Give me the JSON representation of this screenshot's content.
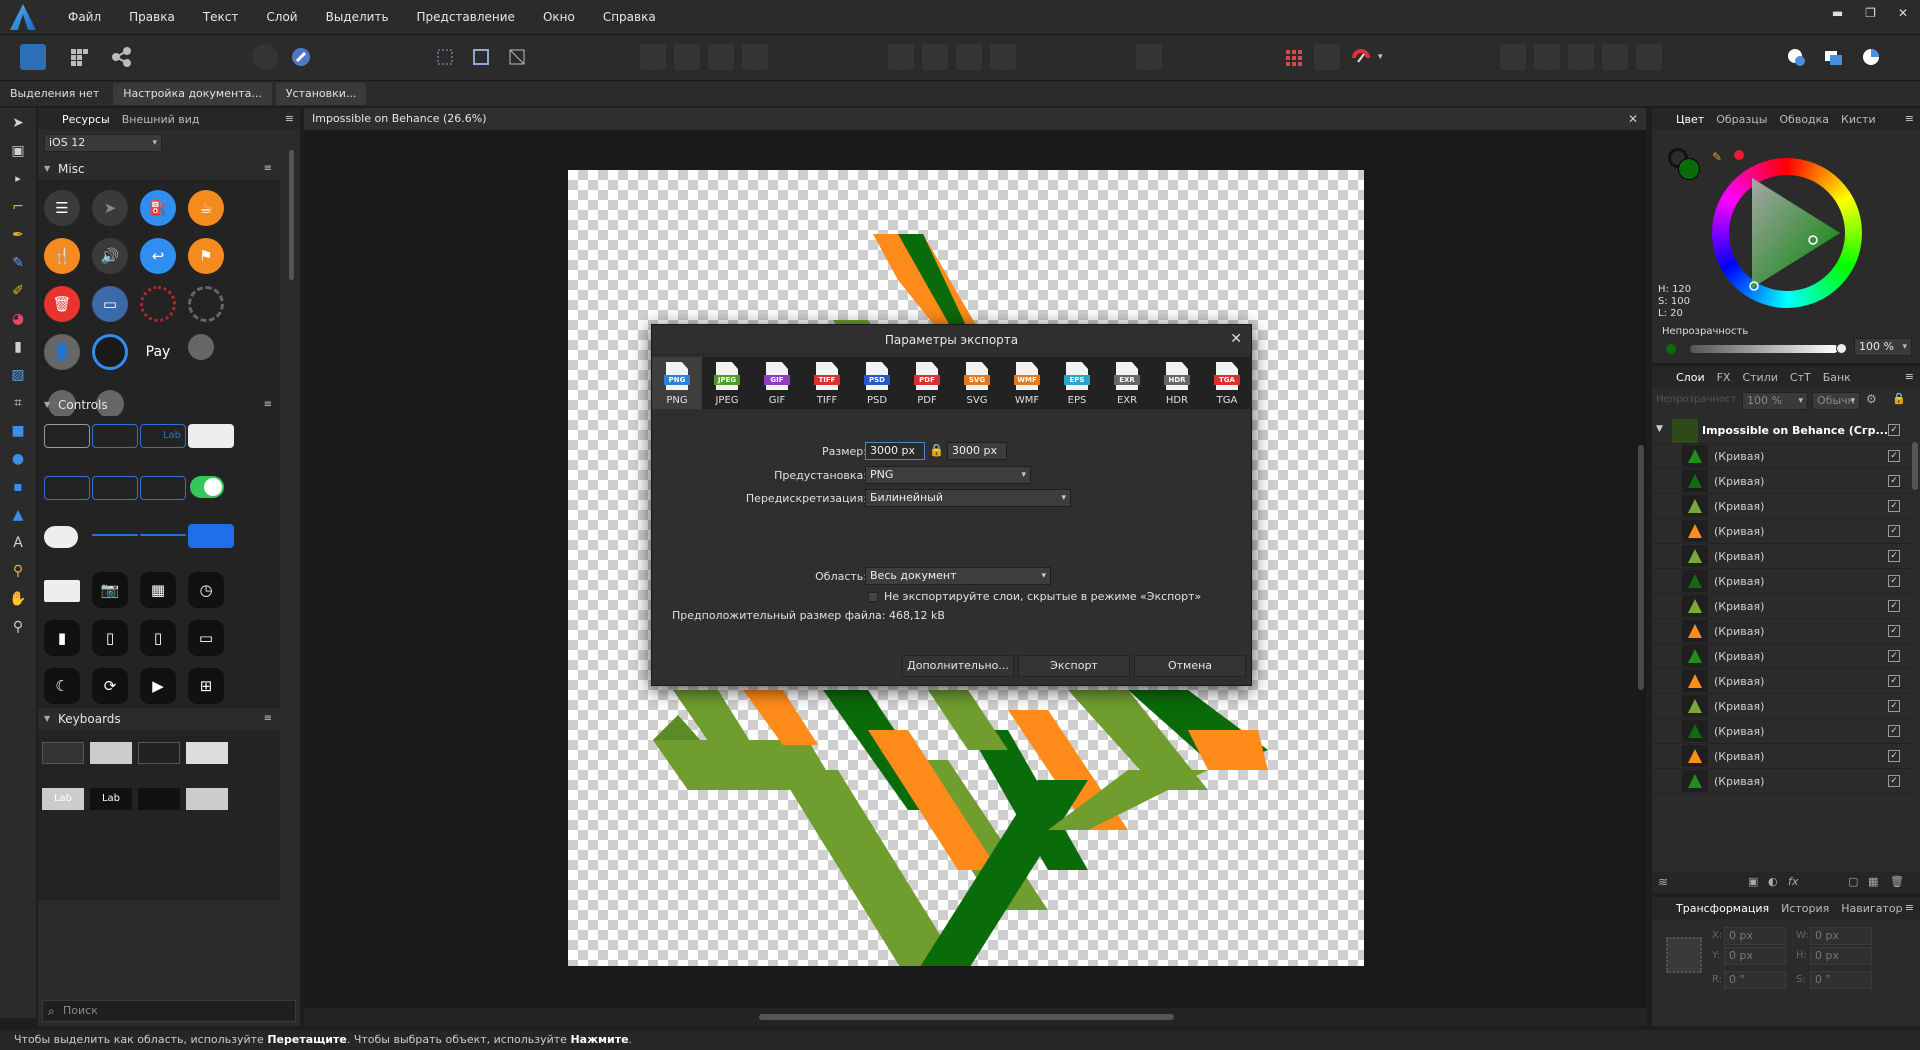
{
  "menubar": {
    "items": [
      "Файл",
      "Правка",
      "Текст",
      "Слой",
      "Выделить",
      "Представление",
      "Окно",
      "Справка"
    ]
  },
  "context_bar": {
    "selection": "Выделения нет",
    "doc_setup": "Настройка документа...",
    "preferences": "Установки..."
  },
  "assets_panel": {
    "tabs": [
      "Ресурсы",
      "Внешний вид"
    ],
    "category": "iOS 12",
    "sections": [
      "Misc",
      "Controls",
      "Keyboards"
    ],
    "search_placeholder": "Поиск",
    "control_label": "Lab",
    "keyboard_label": "Lab"
  },
  "document": {
    "title": "Impossible on Behance (26.6%)"
  },
  "export_dialog": {
    "title": "Параметры экспорта",
    "formats": [
      "PNG",
      "JPEG",
      "GIF",
      "TIFF",
      "PSD",
      "PDF",
      "SVG",
      "WMF",
      "EPS",
      "EXR",
      "HDR",
      "TGA"
    ],
    "format_badges": [
      "PNG",
      "JPEG",
      "GIF",
      "TIFF",
      "PSD",
      "PDF",
      "SVG",
      "WMF",
      "EPS",
      "EXR",
      "HDR",
      "TGA"
    ],
    "format_colors": [
      "#2f7fd6",
      "#4c9a2a",
      "#8c3fc4",
      "#d9322e",
      "#2458c4",
      "#d9322e",
      "#e4781c",
      "#e4781c",
      "#2aa3c9",
      "#666666",
      "#666666",
      "#d9322e"
    ],
    "selected_format": "PNG",
    "size_label": "Размер:",
    "width": "3000 px",
    "height": "3000 px",
    "preset_label": "Предустановка:",
    "preset": "PNG",
    "resample_label": "Передискретизация:",
    "resample": "Билинейный",
    "area_label": "Область:",
    "area": "Весь документ",
    "hidden_layers": "Не экспортируйте слои, скрытые в режиме «Экспорт»",
    "filesize": "Предположительный размер файла: 468,12 kB",
    "btn_more": "Дополнительно...",
    "btn_export": "Экспорт",
    "btn_cancel": "Отмена"
  },
  "color_panel": {
    "tabs": [
      "Цвет",
      "Образцы",
      "Обводка",
      "Кисти"
    ],
    "h": "H: 120",
    "s": "S: 100",
    "l": "L: 20",
    "opacity_label": "Непрозрачность",
    "opacity_value": "100 %",
    "fill_color": "#0a6b0a",
    "accent": "#e81d2f"
  },
  "layers_panel": {
    "tabs": [
      "Слои",
      "FX",
      "Стили",
      "СтТ",
      "Банк"
    ],
    "opacity_label": "Непрозрачность:",
    "opacity_value": "100 %",
    "blend_mode": "Обычн",
    "group_name": "Impossible on Behance (Сгр...",
    "layer_name": "(Кривая)",
    "layers": [
      {
        "name": "(Кривая)",
        "color": "#1f8f1a"
      },
      {
        "name": "(Кривая)",
        "color": "#0f6b0f"
      },
      {
        "name": "(Кривая)",
        "color": "#7aa83a"
      },
      {
        "name": "(Кривая)",
        "color": "#ff8c1a"
      },
      {
        "name": "(Кривая)",
        "color": "#7aa83a"
      },
      {
        "name": "(Кривая)",
        "color": "#0f6b0f"
      },
      {
        "name": "(Кривая)",
        "color": "#7aa83a"
      },
      {
        "name": "(Кривая)",
        "color": "#ff8c1a"
      },
      {
        "name": "(Кривая)",
        "color": "#1f8f1a"
      },
      {
        "name": "(Кривая)",
        "color": "#ff8c1a"
      },
      {
        "name": "(Кривая)",
        "color": "#7aa83a"
      },
      {
        "name": "(Кривая)",
        "color": "#0f6b0f"
      },
      {
        "name": "(Кривая)",
        "color": "#ff8c1a"
      },
      {
        "name": "(Кривая)",
        "color": "#1f8f1a"
      }
    ]
  },
  "transform_panel": {
    "tabs": [
      "Трансформация",
      "История",
      "Навигатор"
    ],
    "x": "0 px",
    "y": "0 px",
    "w": "0 px",
    "h": "0 px",
    "r": "0 °",
    "s": "0 °",
    "lbl_x": "X:",
    "lbl_y": "Y:",
    "lbl_w": "W:",
    "lbl_h": "H:",
    "lbl_r": "R:",
    "lbl_s": "S:"
  },
  "statusbar": {
    "part1": "Чтобы выделить как область, используйте ",
    "bold1": "Перетащите",
    "part2": ". Чтобы выбрать объект, используйте ",
    "bold2": "Нажмите",
    "part3": "."
  },
  "colors": {
    "orange": "#ff8c1a",
    "dark_green": "#0a6b0a",
    "light_green": "#6f9e2e"
  }
}
